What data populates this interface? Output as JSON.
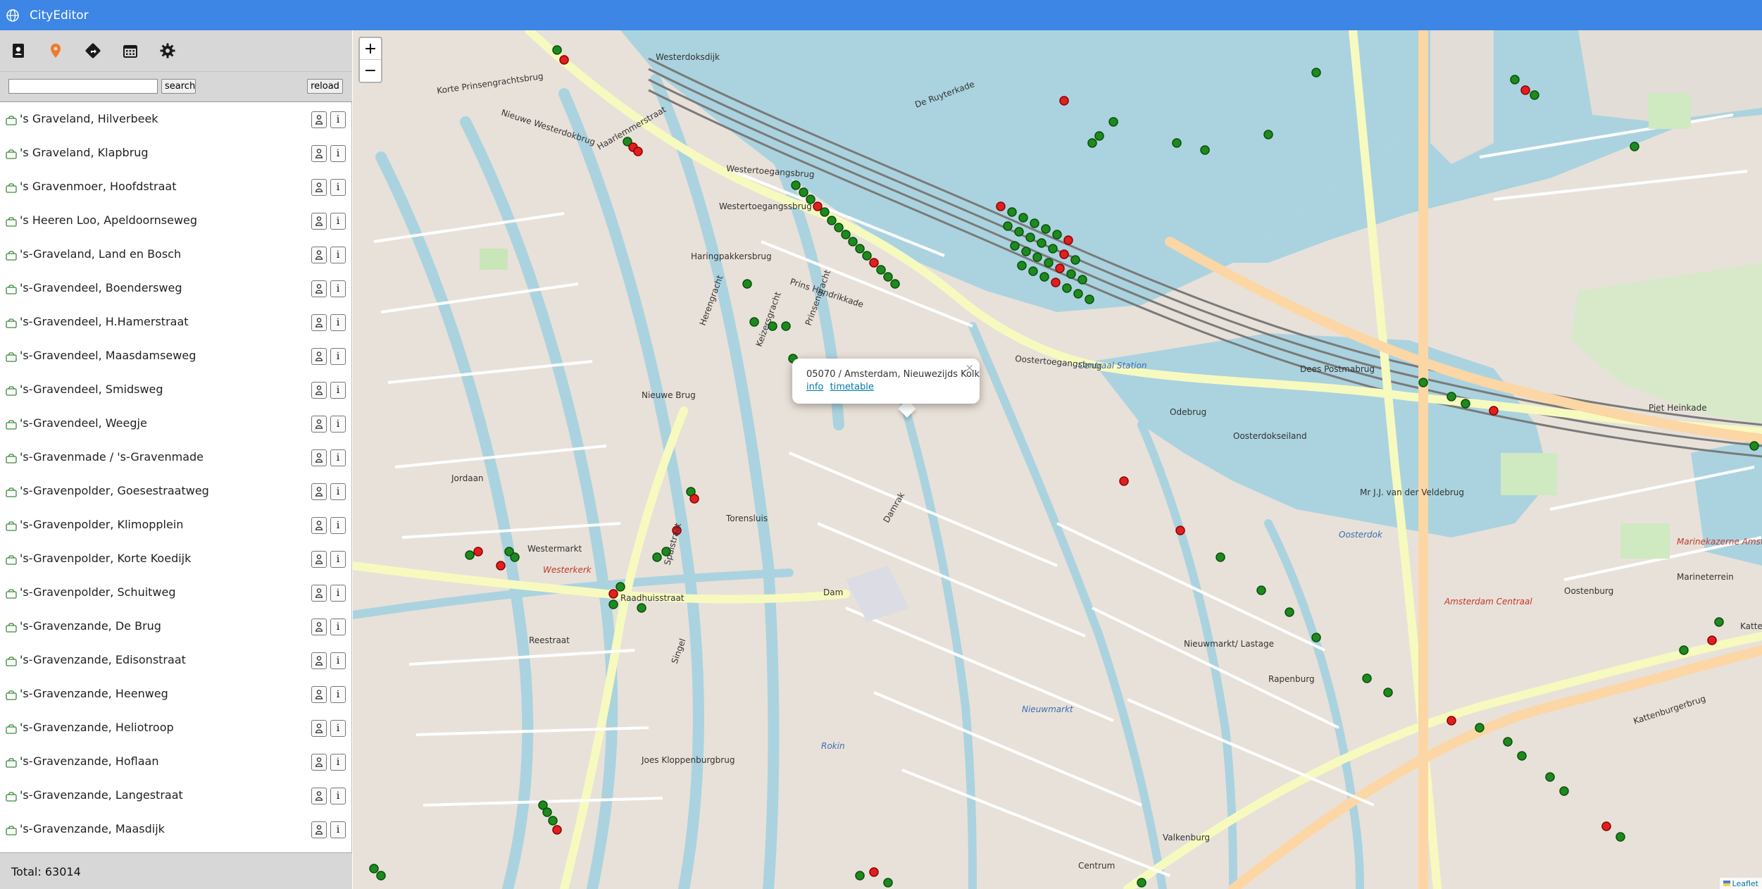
{
  "app": {
    "title": "CityEditor"
  },
  "toolbar": {
    "tools": [
      {
        "name": "contacts-icon"
      },
      {
        "name": "map-pin-icon"
      },
      {
        "name": "directions-icon"
      },
      {
        "name": "calendar-icon"
      },
      {
        "name": "gear-icon"
      }
    ],
    "search_placeholder": "",
    "search_label": "search",
    "reload_label": "reload"
  },
  "stops": [
    {
      "name": "'s Graveland, Hilverbeek"
    },
    {
      "name": "'s Graveland, Klapbrug"
    },
    {
      "name": "'s Gravenmoer, Hoofdstraat"
    },
    {
      "name": "'s Heeren Loo, Apeldoornseweg"
    },
    {
      "name": "'s-Graveland, Land en Bosch"
    },
    {
      "name": "'s-Gravendeel, Boendersweg"
    },
    {
      "name": "'s-Gravendeel, H.Hamerstraat"
    },
    {
      "name": "'s-Gravendeel, Maasdamseweg"
    },
    {
      "name": "'s-Gravendeel, Smidsweg"
    },
    {
      "name": "'s-Gravendeel, Weegje"
    },
    {
      "name": "'s-Gravenmade / 's-Gravenmade"
    },
    {
      "name": "'s-Gravenpolder, Goesestraatweg"
    },
    {
      "name": "'s-Gravenpolder, Klimopplein"
    },
    {
      "name": "'s-Gravenpolder, Korte Koedijk"
    },
    {
      "name": "'s-Gravenpolder, Schuitweg"
    },
    {
      "name": "'s-Gravenzande, De Brug"
    },
    {
      "name": "'s-Gravenzande, Edisonstraat"
    },
    {
      "name": "'s-Gravenzande, Heenweg"
    },
    {
      "name": "'s-Gravenzande, Heliotroop"
    },
    {
      "name": "'s-Gravenzande, Hoflaan"
    },
    {
      "name": "'s-Gravenzande, Langestraat"
    },
    {
      "name": "'s-Gravenzande, Maasdijk"
    }
  ],
  "footer": {
    "total": "Total: 63014"
  },
  "map": {
    "zoom_in": "+",
    "zoom_out": "−",
    "popup": {
      "text": "05070 / Amsterdam, Nieuwezijds Kolk",
      "info_link": "info",
      "timetable_link": "timetable",
      "close": "×"
    },
    "attribution": "Leaflet",
    "labels": [
      "Westerdoksdijk",
      "Korte Prinsengrachtsbrug",
      "Nieuwe Westerdokbrug",
      "Westertoegangsbrug",
      "Westertoegangssbrug",
      "Haringpakkersbrug",
      "Prins Hendrikkade",
      "Nieuwe Brug",
      "Oostertoegangsbrug",
      "Centraal Station",
      "Odebrug",
      "Dees Postmabrug",
      "Piet Heinkade",
      "Oostenburg",
      "Oosterdok",
      "Nieuwmarkt/ Lastage",
      "Rapenburg",
      "Kattenburg",
      "Kattenburgerbrug",
      "Marinekazerne Amsterdam",
      "Marineterrein",
      "Dam",
      "Rokin",
      "Torensluis",
      "Westermarkt",
      "Jordaan",
      "Reestraat",
      "Raadhuisstraat",
      "Joes Kloppenburgbrug",
      "Nieuwmarkt",
      "Valkenburg",
      "Centrum",
      "Singel",
      "Amsterdam Centraal",
      "Oosterdokseiland",
      "Mr J.J. van der Veldebrug",
      "Spuistraat",
      "Damrak",
      "Westerkerk",
      "Herengracht",
      "Keizersgracht",
      "Prinsengracht",
      "Haarlemmerstraat",
      "De Ruyterkade"
    ]
  }
}
